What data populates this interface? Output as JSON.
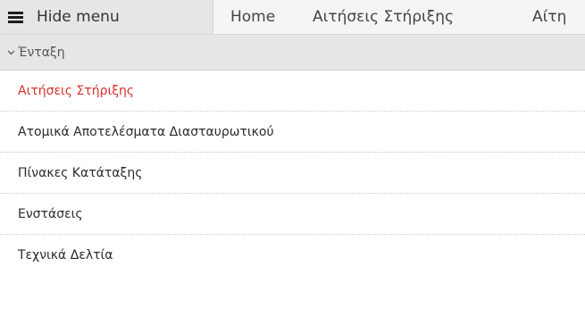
{
  "topbar": {
    "hide_menu_label": "Hide menu",
    "nav": {
      "home": "Home",
      "support": "Αιτήσεις Στήριξης",
      "third": "Αίτη"
    }
  },
  "sidebar": {
    "section_title": "Ένταξη",
    "items": [
      {
        "label": "Αιτήσεις Στήριξης"
      },
      {
        "label": "Ατομικά Αποτελέσματα Διασταυρωτικού"
      },
      {
        "label": "Πίνακες Κατάταξης"
      },
      {
        "label": "Ενστάσεις"
      },
      {
        "label": "Τεχνικά Δελτία"
      }
    ]
  },
  "colors": {
    "active_item": "#d9302d",
    "header_bg": "#e6e6e6"
  }
}
